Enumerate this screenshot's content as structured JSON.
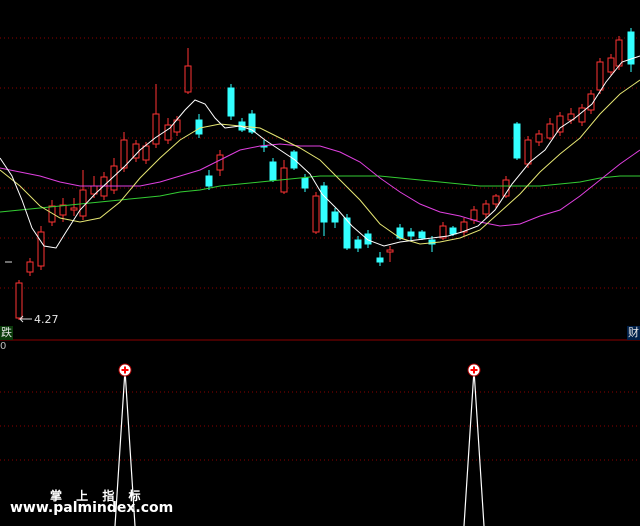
{
  "labels": {
    "left_tag": "跌",
    "right_tag": "财",
    "corner_tag": "0",
    "low_price": "4.27"
  },
  "watermark": {
    "title": "掌 上 指 标",
    "url": "www.palmindex.com"
  },
  "colors": {
    "background": "#000000",
    "up_candle": "#ff3333",
    "down_candle": "#33ffff",
    "ma_white": "#ffffff",
    "ma_yellow": "#e6e673",
    "ma_magenta": "#e040e0",
    "ma_green": "#33cc33",
    "grid": "#8b0000",
    "signal_marker": "#ff0000"
  },
  "chart_data": {
    "type": "candlestick",
    "low_label": "4.27",
    "signals": [
      {
        "index": 9,
        "value": 1
      },
      {
        "index": 38,
        "value": 1
      }
    ]
  }
}
